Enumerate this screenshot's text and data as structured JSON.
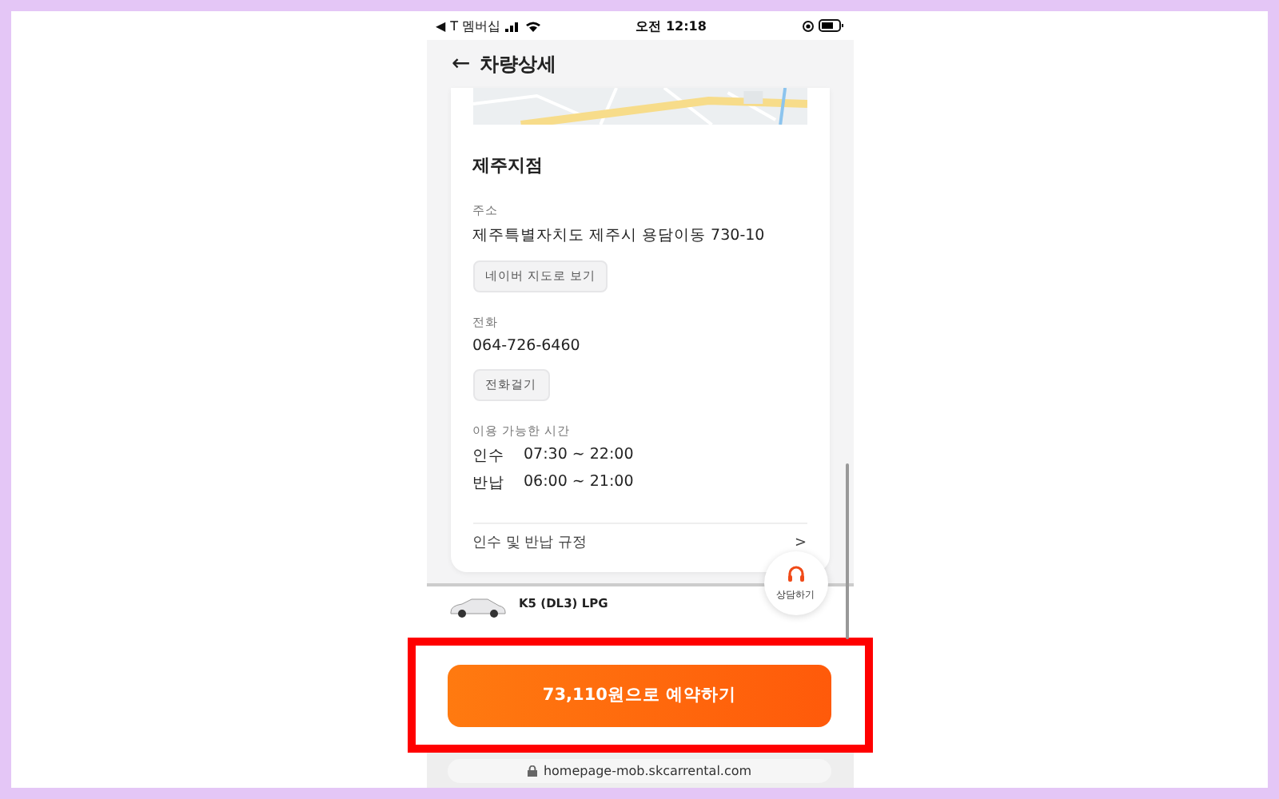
{
  "status_bar": {
    "back_app": "◀",
    "carrier": "T 멤버십",
    "time": "오전 12:18"
  },
  "header": {
    "back": "←",
    "title": "차량상세"
  },
  "branch": {
    "name": "제주지점",
    "sections": [
      {
        "label": "주소",
        "value": "제주특별자치도 제주시 용담이동 730-10",
        "button": "네이버 지도로 보기"
      },
      {
        "label": "전화",
        "value": "064-726-6460",
        "button": "전화걸기"
      }
    ],
    "hours": {
      "label": "이용 가능한 시간",
      "rows": [
        {
          "name": "인수",
          "time": "07:30 ~ 22:00"
        },
        {
          "name": "반납",
          "time": "06:00 ~ 21:00"
        }
      ]
    },
    "rules_link": {
      "label": "인수 및 반납 규정",
      "arrow": ">"
    }
  },
  "consult_button": {
    "label": "상담하기"
  },
  "car": {
    "name": "K5 (DL3) LPG"
  },
  "reserve_button": {
    "label": "73,110원으로 예약하기"
  },
  "url_bar": {
    "url": "homepage-mob.skcarrental.com"
  }
}
